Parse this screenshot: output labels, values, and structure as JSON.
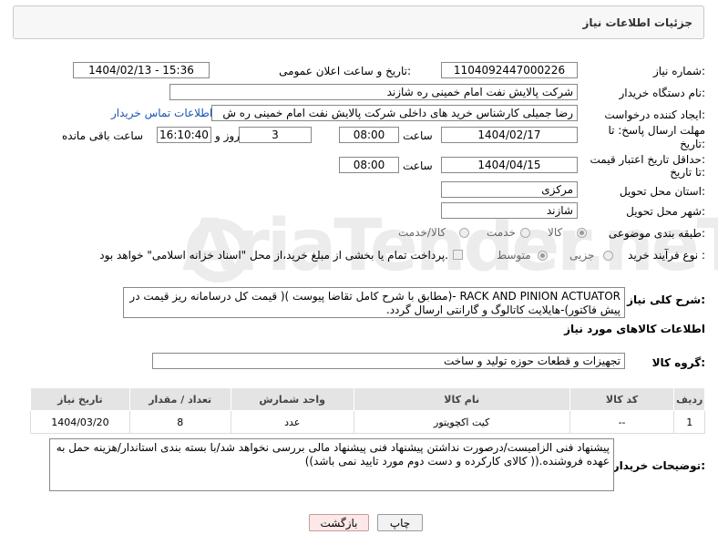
{
  "header": {
    "title": "جزئیات اطلاعات نیاز"
  },
  "form": {
    "need_number_label": "شماره نیاز:",
    "need_number": "1104092447000226",
    "announce_label": "تاریخ و ساعت اعلان عمومی:",
    "announce_value": "1404/02/13 - 15:36",
    "buyer_label": "نام دستگاه خریدار:",
    "buyer_value": "شرکت پالایش نفت امام خمینی  ره  شازند",
    "creator_label": "ایجاد کننده درخواست:",
    "creator_value": "رضا جمیلی کارشناس خرید های داخلی  شرکت پالایش نفت امام خمینی  ره  ش",
    "contact_link": "اطلاعات تماس خریدار",
    "deadline_label_1": "مهلت ارسال پاسخ: تا",
    "deadline_label_2": "تاریخ:",
    "deadline_date": "1404/02/17",
    "time_label": "ساعت",
    "deadline_time": "08:00",
    "days_value": "3",
    "days_label": "روز و",
    "remaining_time": "16:10:40",
    "remaining_label": "ساعت باقی مانده",
    "validity_label_1": "حداقل تاریخ اعتبار قیمت:",
    "validity_label_2": "تا تاریخ:",
    "validity_date": "1404/04/15",
    "validity_time": "08:00",
    "province_label": "استان محل تحویل:",
    "province_value": "مرکزی",
    "city_label": "شهر محل تحویل:",
    "city_value": "شازند",
    "category_label": "طبقه بندی موضوعی:",
    "category_options": [
      "کالا",
      "خدمت",
      "کالا/خدمت"
    ],
    "process_label": "نوع فرآیند خرید :",
    "process_options": [
      "جزیی",
      "متوسط"
    ],
    "payment_note": "پرداخت تمام یا بخشی از مبلغ خرید،از محل \"اسناد خزانه اسلامی\" خواهد بود."
  },
  "description": {
    "label": "شرح کلی نیاز:",
    "text": "RACK AND PINION ACTUATOR -(مطابق با شرح کامل تقاضا پیوست )( قیمت کل درسامانه ریز قیمت در پیش فاکتور)-هایلایت کاتالوگ و گارانتی ارسال گردد."
  },
  "goods_section": {
    "title": "اطلاعات کالاهای مورد نیاز",
    "group_label": "گروه کالا:",
    "group_value": "تجهیزات و قطعات حوزه تولید و ساخت"
  },
  "table": {
    "headers": [
      "ردیف",
      "کد کالا",
      "نام کالا",
      "واحد شمارش",
      "تعداد / مقدار",
      "تاریخ نیاز"
    ],
    "rows": [
      [
        "1",
        "--",
        "کیت اکچویتور",
        "عدد",
        "8",
        "1404/03/20"
      ]
    ]
  },
  "buyer_notes": {
    "label": "توضیحات خریدار:",
    "text": "پیشنهاد فنی الزامیست/درصورت نداشتن پیشنهاد فنی پیشنهاد مالی بررسی نخواهد شد/با بسته بندی استاندار/هزینه حمل به عهده فروشنده.(( کالای کارکرده و دست دوم مورد تایید نمی باشد))"
  },
  "buttons": {
    "print": "چاپ",
    "back": "بازگشت"
  },
  "watermark": "AriaTender.neT"
}
